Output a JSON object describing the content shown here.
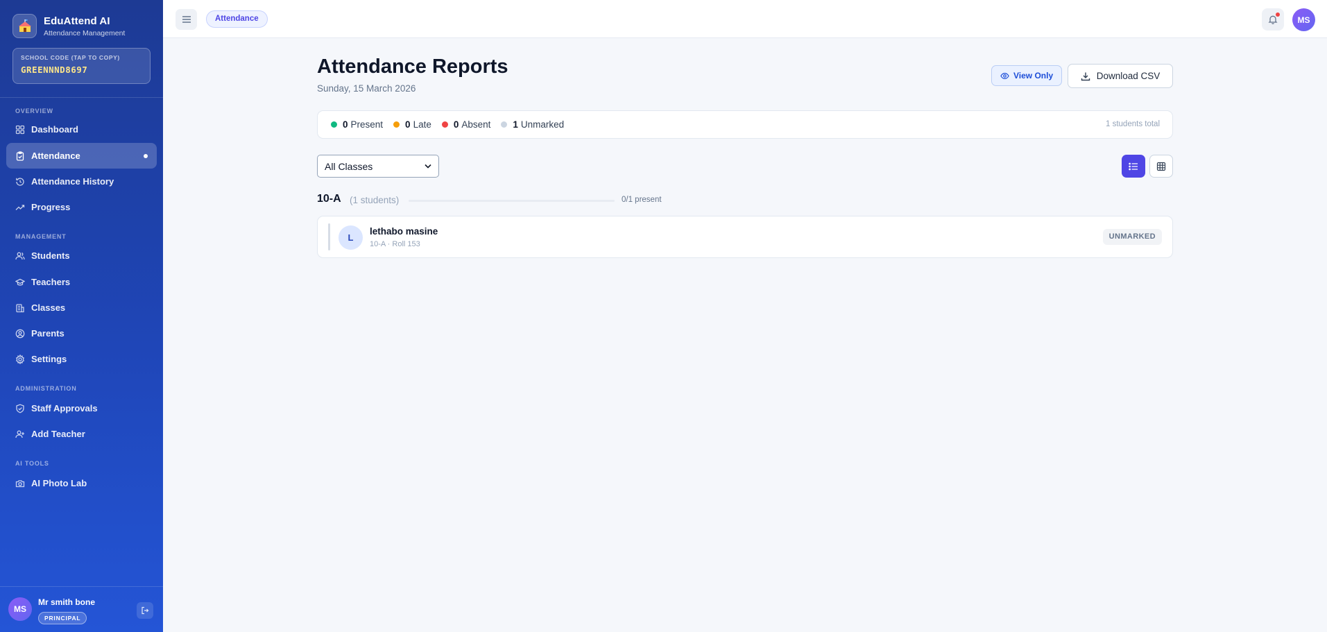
{
  "app": {
    "name": "EduAttend AI",
    "subtitle": "Attendance Management"
  },
  "school_code": {
    "label": "SCHOOL CODE (TAP TO COPY)",
    "value": "GREENNND8697"
  },
  "sidebar": {
    "sections": [
      {
        "label": "OVERVIEW"
      },
      {
        "label": "MANAGEMENT"
      },
      {
        "label": "ADMINISTRATION"
      },
      {
        "label": "AI TOOLS"
      }
    ],
    "items": [
      {
        "label": "Dashboard",
        "icon": "grid-icon"
      },
      {
        "label": "Attendance",
        "icon": "clipboard-check-icon",
        "active": true
      },
      {
        "label": "Attendance History",
        "icon": "history-icon"
      },
      {
        "label": "Progress",
        "icon": "trending-up-icon"
      },
      {
        "label": "Students",
        "icon": "users-icon"
      },
      {
        "label": "Teachers",
        "icon": "graduation-cap-icon"
      },
      {
        "label": "Classes",
        "icon": "building-icon"
      },
      {
        "label": "Parents",
        "icon": "user-circle-icon"
      },
      {
        "label": "Settings",
        "icon": "gear-icon"
      },
      {
        "label": "Staff Approvals",
        "icon": "shield-check-icon"
      },
      {
        "label": "Add Teacher",
        "icon": "user-plus-icon"
      },
      {
        "label": "AI Photo Lab",
        "icon": "camera-icon"
      }
    ]
  },
  "user": {
    "initials": "MS",
    "name": "Mr smith bone",
    "role": "PRINCIPAL"
  },
  "topbar": {
    "breadcrumb": "Attendance",
    "avatar_initials": "MS"
  },
  "page": {
    "title": "Attendance Reports",
    "date": "Sunday, 15 March 2026",
    "view_only_label": "View Only",
    "download_label": "Download CSV"
  },
  "stats": {
    "items": [
      {
        "count": "0",
        "label": "Present",
        "color": "#10b981"
      },
      {
        "count": "0",
        "label": "Late",
        "color": "#f59e0b"
      },
      {
        "count": "0",
        "label": "Absent",
        "color": "#ef4444"
      },
      {
        "count": "1",
        "label": "Unmarked",
        "color": "#cbd5e1"
      }
    ],
    "total_label": "1 students total"
  },
  "filter": {
    "selected": "All Classes"
  },
  "groups": [
    {
      "name": "10-A",
      "count_label": "(1 students)",
      "present_label": "0/1 present",
      "present_fraction": 0,
      "students": [
        {
          "initial": "L",
          "name": "lethabo masine",
          "meta": "10-A · Roll 153",
          "status": "UNMARKED"
        }
      ]
    }
  ]
}
